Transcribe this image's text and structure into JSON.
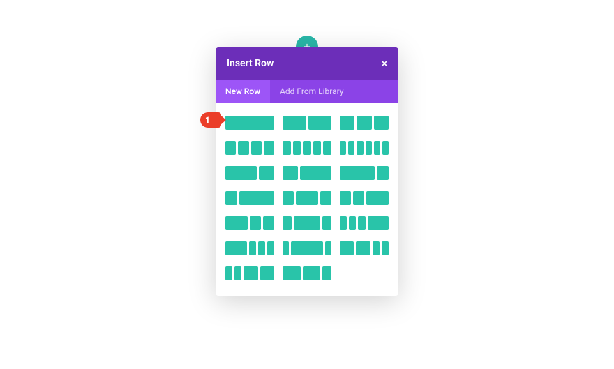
{
  "add_button": {
    "plus": "+"
  },
  "modal": {
    "title": "Insert Row",
    "close": "×",
    "tabs": {
      "new_row": "New Row",
      "add_from_library": "Add From Library",
      "active": "new_row"
    }
  },
  "callout": {
    "label": "1"
  },
  "layouts": [
    [
      1
    ],
    [
      1,
      1
    ],
    [
      1,
      1,
      1
    ],
    [
      1,
      1,
      1,
      1
    ],
    [
      1,
      1,
      1,
      1,
      1
    ],
    [
      1,
      1,
      1,
      1,
      1,
      1
    ],
    [
      2,
      1
    ],
    [
      1,
      2
    ],
    [
      3,
      1
    ],
    [
      1,
      3
    ],
    [
      1,
      2,
      1
    ],
    [
      1,
      1,
      2
    ],
    [
      2,
      1,
      1
    ],
    [
      1,
      3,
      1
    ],
    [
      1,
      1,
      1,
      3
    ],
    [
      3,
      1,
      1,
      1
    ],
    [
      1,
      5,
      1
    ],
    [
      2,
      2,
      1,
      1
    ],
    [
      1,
      1,
      2,
      2
    ],
    [
      2,
      2,
      1
    ]
  ],
  "colors": {
    "accent": "#29c4a9",
    "header": "#6c2eb9",
    "tabs": "#8b43e7",
    "tab_active": "#9d55f7",
    "callout": "#eb3e29"
  }
}
